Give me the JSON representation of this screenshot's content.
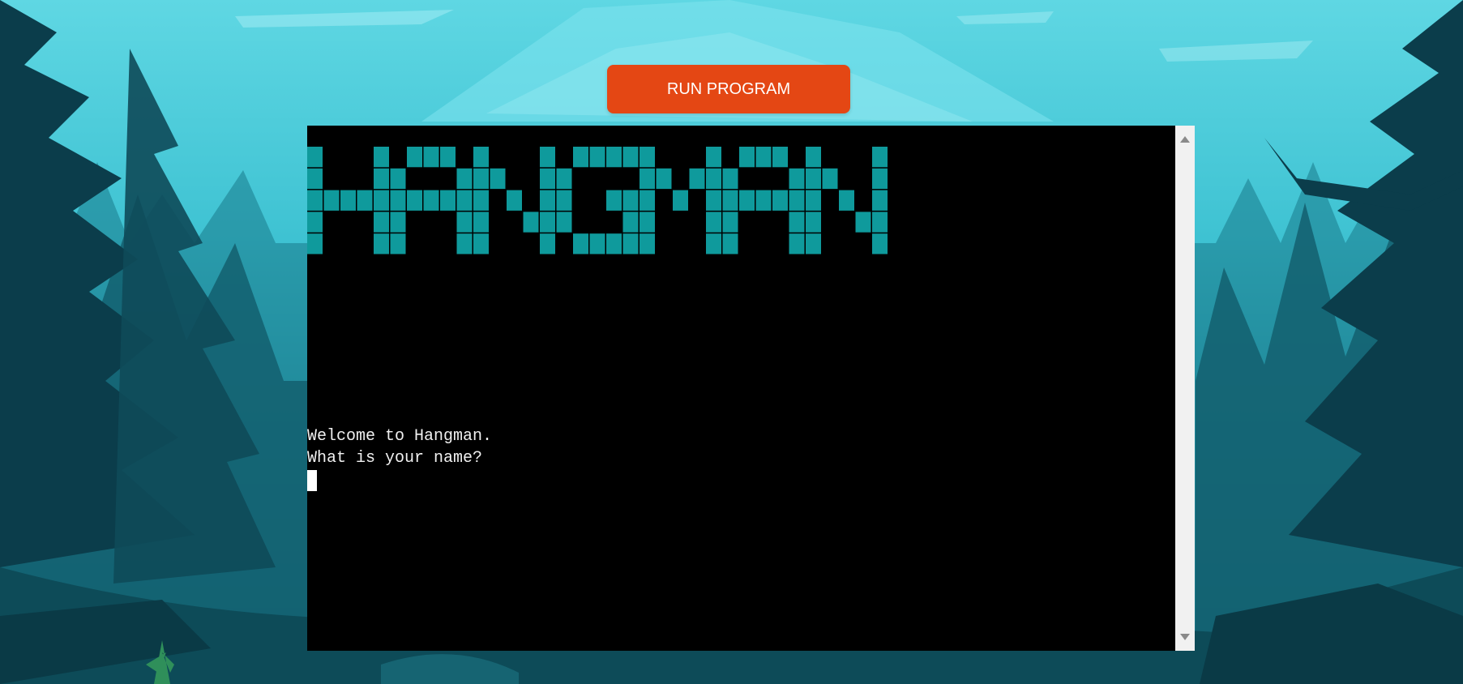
{
  "run_button": {
    "label": "RUN PROGRAM",
    "color": "#e44714"
  },
  "terminal": {
    "banner_text": "HANGMAN",
    "banner_color": "#0f9a9c",
    "lines": [
      "Welcome to Hangman.",
      "What is your name?"
    ],
    "background": "#000000",
    "text_color": "#f0f0f0"
  },
  "scrollbar": {
    "up_icon": "triangle-up-icon",
    "down_icon": "triangle-down-icon"
  },
  "background": {
    "scene": "forest-mountain-landscape",
    "palette": [
      "#56d3e0",
      "#2a9eb0",
      "#125e6e",
      "#0b3d4b"
    ]
  }
}
